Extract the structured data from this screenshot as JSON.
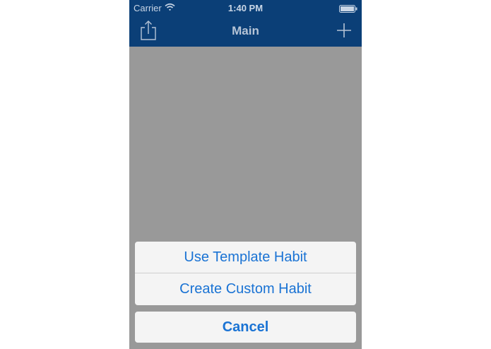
{
  "status_bar": {
    "carrier": "Carrier",
    "time": "1:40 PM"
  },
  "nav_bar": {
    "title": "Main",
    "left_icon": "share-icon",
    "right_icon": "plus-icon"
  },
  "action_sheet": {
    "items": [
      {
        "label": "Use Template Habit"
      },
      {
        "label": "Create Custom Habit"
      }
    ],
    "cancel_label": "Cancel"
  },
  "colors": {
    "nav_background": "#0b3f77",
    "overlay": "#999999",
    "action_text": "#1a73d4",
    "sheet_background": "#f4f4f4"
  }
}
